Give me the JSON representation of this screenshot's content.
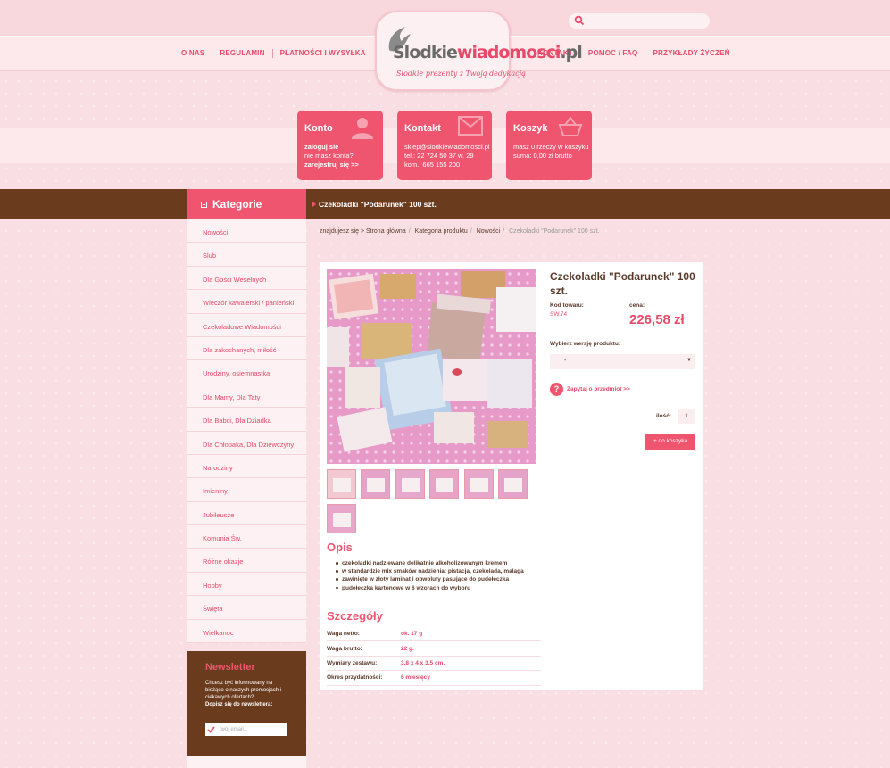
{
  "header": {
    "search_placeholder": "",
    "nav_left": [
      "O NAS",
      "REGULAMIN",
      "PŁATNOŚCI I WYSYŁKA"
    ],
    "nav_right": [
      "KONTAKT",
      "POMOC / FAQ",
      "PRZYKŁADY ŻYCZEŃ"
    ],
    "logo_main": "Slodkie",
    "logo_accent": "wiadomosci",
    "logo_suffix": ".pl",
    "logo_tagline": "Słodkie prezenty z Twoją dedykacją"
  },
  "boxes": {
    "konto": {
      "title": "Konto",
      "lines": [
        "zaloguj się",
        "nie masz konta?",
        "zarejestruj się >>"
      ]
    },
    "kontakt": {
      "title": "Kontakt",
      "lines": [
        "sklep@slodkiewiadomosci.pl",
        "tel.: 22 724 50 37 w. 29",
        "kom.: 665 155 200"
      ]
    },
    "koszyk": {
      "title": "Koszyk",
      "lines": [
        "masz 0 rzeczy w koszyku",
        "suma: 0,00 zł brutto"
      ]
    }
  },
  "sidebar": {
    "title": "Kategorie",
    "items": [
      "Nowości",
      "Ślub",
      "Dla Gości Weselnych",
      "Wieczór kawalerski / panieński",
      "Czekoladowe Wiadomości",
      "Dla zakochanych, miłość",
      "Urodziny, osiemnastka",
      "Dla Mamy, Dla Taty",
      "Dla Babci, Dla Dziadka",
      "Dla Chłopaka, Dla Dziewczyny",
      "Narodziny",
      "Imieniny",
      "Jubileusze",
      "Komunia Św.",
      "Różne okazje",
      "Hobby",
      "Święta",
      "Wielkanoc"
    ]
  },
  "newsletter": {
    "title": "Newsletter",
    "text": "Chcesz być informowany na bieżąco o naszych promocjach i ciekawych ofertach?",
    "cta": "Dopisz się do newslettera:",
    "placeholder": "twój email..."
  },
  "page": {
    "title": "Czekoladki \"Podarunek\" 100 szt.",
    "breadcrumb_prefix": "znajdujesz się >",
    "breadcrumb": [
      "Strona główna",
      "Kategoria produktu",
      "Nowości",
      "Czekoladki \"Podarunek\" 100 szt."
    ]
  },
  "product": {
    "name": "Czekoladki \"Podarunek\" 100 szt.",
    "code_label": "Kod towaru:",
    "code": "SW.74",
    "price_label": "cena:",
    "price": "226,58 zł",
    "variant_label": "Wybierz wersję produktu:",
    "variant_value": "-",
    "ask": "Zapytaj o przedmiot >>",
    "qty_label": "ilość:",
    "qty": "1",
    "cart_button": "+ do koszyka"
  },
  "description": {
    "title": "Opis",
    "items": [
      "czekoladki nadziewane delikatnie alkoholizowanym kremem",
      "w standardzie mix smaków nadzienia: pistacja, czekolada, malaga",
      "zawinięte w złoty laminat i obwoluty pasujące do pudełeczka",
      "pudełeczka kartonowe w 6 wzorach do wyboru"
    ]
  },
  "details": {
    "title": "Szczegóły",
    "rows": [
      {
        "k": "Waga netto:",
        "v": "ok. 17 g"
      },
      {
        "k": "Waga brutto:",
        "v": "22 g."
      },
      {
        "k": "Wymiary zestawu:",
        "v": "3,8 x 4 x 3,5 cm."
      },
      {
        "k": "Okres przydatności:",
        "v": "6 miesięcy"
      }
    ]
  },
  "colors": {
    "accent": "#f0556f",
    "brown": "#6b3b1e",
    "background": "#f9dfe3"
  }
}
